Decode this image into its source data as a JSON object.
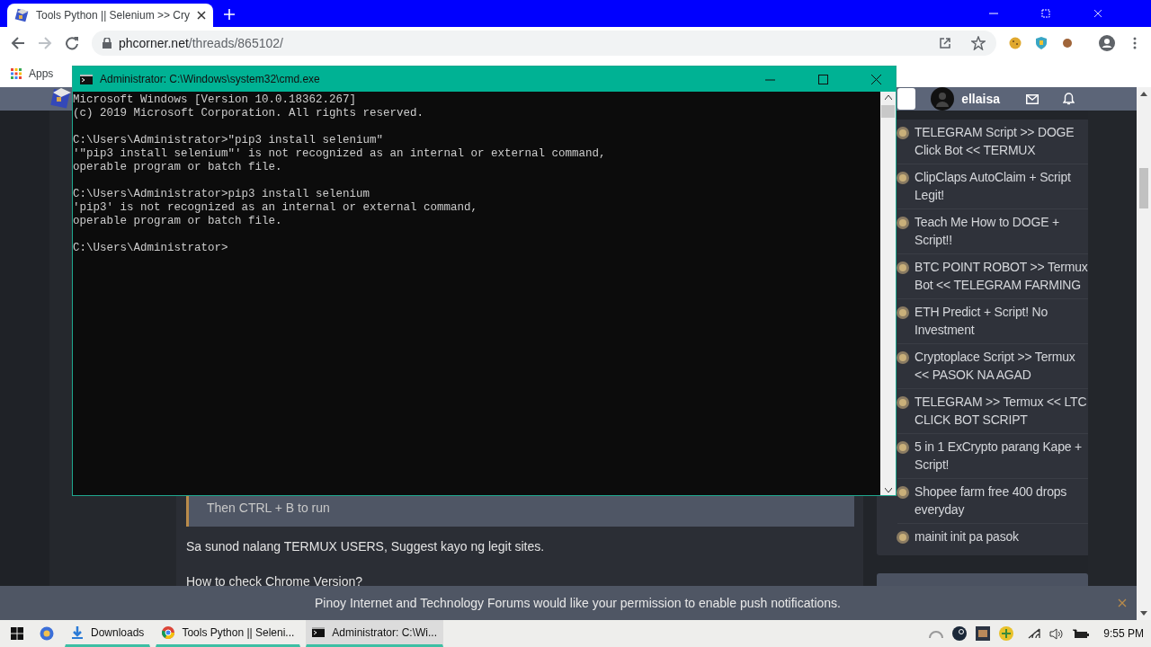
{
  "browser": {
    "tab_title": "Tools Python || Selenium >> Cry",
    "url_host": "phcorner.net",
    "url_path": "/threads/865102/",
    "bookmarks": [
      "Apps"
    ]
  },
  "forum_header": {
    "username": "ellaisa"
  },
  "post": {
    "quote": "Then CTRL + B to run",
    "paragraphs": [
      "Sa sunod nalang TERMUX USERS, Suggest kayo ng legit sites.",
      "How to check Chrome Version?"
    ]
  },
  "sidebar": {
    "threads": [
      {
        "title": "TELEGRAM Script >> DOGE Click Bot << TERMUX"
      },
      {
        "title": "ClipClaps AutoClaim + Script Legit!"
      },
      {
        "title": "Teach Me How to DOGE + Script!!"
      },
      {
        "title": "BTC POINT ROBOT >> Termux Bot << TELEGRAM FARMING"
      },
      {
        "title": "ETH Predict + Script! No Investment"
      },
      {
        "title": "Cryptoplace Script >> Termux << PASOK NA AGAD"
      },
      {
        "title": "TELEGRAM >> Termux << LTC CLICK BOT SCRIPT"
      },
      {
        "title": "5 in 1 ExCrypto parang Kape + Script!"
      },
      {
        "title": "Shopee farm free 400 drops everyday"
      },
      {
        "title": "mainit init pa pasok"
      }
    ]
  },
  "notification": {
    "text": "Pinoy Internet and Technology Forums would like your permission to enable push notifications."
  },
  "console_window": {
    "title": "Administrator: C:\\Windows\\system32\\cmd.exe",
    "blocks": [
      [
        "Microsoft Windows [Version 10.0.18362.267]",
        "(c) 2019 Microsoft Corporation. All rights reserved."
      ],
      [
        "C:\\Users\\Administrator>\"pip3 install selenium\"",
        "'\"pip3 install selenium\"' is not recognized as an internal or external command,",
        "operable program or batch file."
      ],
      [
        "C:\\Users\\Administrator>pip3 install selenium",
        "'pip3' is not recognized as an internal or external command,",
        "operable program or batch file."
      ],
      [
        "C:\\Users\\Administrator>"
      ]
    ]
  },
  "taskbar": {
    "items": [
      {
        "kind": "folder",
        "label": "Downloads",
        "selected": false
      },
      {
        "kind": "browser",
        "label": "Tools Python || Seleni...",
        "selected": false
      },
      {
        "kind": "console",
        "label": "Administrator: C:\\Wi...",
        "selected": true
      }
    ],
    "clock": "9:55 PM"
  }
}
